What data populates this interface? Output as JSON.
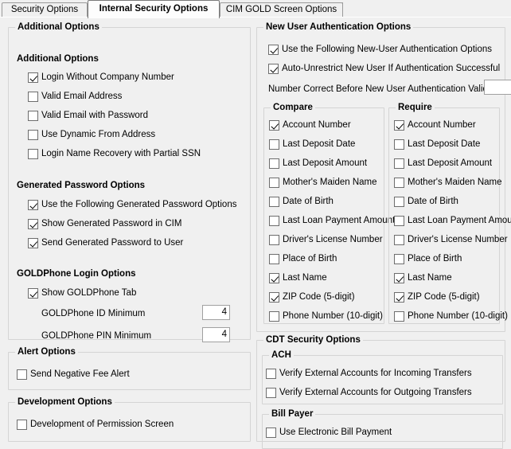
{
  "tabs": [
    {
      "id": "security-options",
      "label": "Security Options",
      "active": false
    },
    {
      "id": "internal-security-options",
      "label": "Internal Security Options",
      "active": true
    },
    {
      "id": "cim-gold-screen-options",
      "label": "CIM GOLD Screen Options",
      "active": false
    }
  ],
  "left": {
    "additional_options": {
      "group_title": "Additional Options",
      "section_head": "Additional Options",
      "items": [
        {
          "label": "Login Without Company Number",
          "checked": true
        },
        {
          "label": "Valid Email Address",
          "checked": false
        },
        {
          "label": "Valid Email with Password",
          "checked": false
        },
        {
          "label": "Use Dynamic From Address",
          "checked": false
        },
        {
          "label": "Login Name Recovery with Partial SSN",
          "checked": false
        }
      ]
    },
    "generated_password": {
      "section_head": "Generated Password Options",
      "items": [
        {
          "label": "Use the Following Generated Password Options",
          "checked": true
        },
        {
          "label": "Show Generated Password in CIM",
          "checked": true
        },
        {
          "label": "Send Generated Password to User",
          "checked": true
        }
      ]
    },
    "goldphone": {
      "section_head": "GOLDPhone Login Options",
      "items": [
        {
          "label": "Show GOLDPhone Tab",
          "checked": true
        }
      ],
      "fields": [
        {
          "label": "GOLDPhone ID Minimum",
          "value": "4"
        },
        {
          "label": "GOLDPhone PIN Minimum",
          "value": "4"
        }
      ]
    },
    "alert_options": {
      "group_title": "Alert Options",
      "items": [
        {
          "label": "Send Negative Fee Alert",
          "checked": false
        }
      ]
    },
    "development_options": {
      "group_title": "Development Options",
      "items": [
        {
          "label": "Development of Permission Screen",
          "checked": false
        }
      ]
    }
  },
  "right": {
    "new_user_auth": {
      "group_title": "New User Authentication Options",
      "items": [
        {
          "label": "Use the Following New-User Authentication Options",
          "checked": true
        },
        {
          "label": "Auto-Unrestrict New User If Authentication Successful",
          "checked": true
        }
      ],
      "number_correct": {
        "label": "Number Correct Before New User Authentication Valid",
        "value": ""
      },
      "compare": {
        "group_title": "Compare",
        "items": [
          {
            "label": "Account Number",
            "checked": true
          },
          {
            "label": "Last Deposit Date",
            "checked": false
          },
          {
            "label": "Last Deposit Amount",
            "checked": false
          },
          {
            "label": "Mother's Maiden Name",
            "checked": false
          },
          {
            "label": "Date of Birth",
            "checked": false
          },
          {
            "label": "Last Loan Payment Amount",
            "checked": false
          },
          {
            "label": "Driver's License Number",
            "checked": false
          },
          {
            "label": "Place of Birth",
            "checked": false
          },
          {
            "label": "Last Name",
            "checked": true
          },
          {
            "label": "ZIP Code (5-digit)",
            "checked": true
          },
          {
            "label": "Phone Number (10-digit)",
            "checked": false
          }
        ]
      },
      "require": {
        "group_title": "Require",
        "items": [
          {
            "label": "Account Number",
            "checked": true
          },
          {
            "label": "Last Deposit Date",
            "checked": false
          },
          {
            "label": "Last Deposit Amount",
            "checked": false
          },
          {
            "label": "Mother's Maiden Name",
            "checked": false
          },
          {
            "label": "Date of Birth",
            "checked": false
          },
          {
            "label": "Last Loan Payment Amount",
            "checked": false
          },
          {
            "label": "Driver's License Number",
            "checked": false
          },
          {
            "label": "Place of Birth",
            "checked": false
          },
          {
            "label": "Last Name",
            "checked": true
          },
          {
            "label": "ZIP Code (5-digit)",
            "checked": true
          },
          {
            "label": "Phone Number (10-digit)",
            "checked": false
          }
        ]
      }
    },
    "cdt_security": {
      "group_title": "CDT Security Options",
      "ach": {
        "group_title": "ACH",
        "items": [
          {
            "label": "Verify External Accounts for Incoming Transfers",
            "checked": false
          },
          {
            "label": "Verify External Accounts for Outgoing Transfers",
            "checked": false
          }
        ]
      },
      "bill_payer": {
        "group_title": "Bill Payer",
        "items": [
          {
            "label": "Use Electronic Bill Payment",
            "checked": false
          }
        ]
      }
    }
  },
  "colors": {
    "background": "#f0f0f0",
    "group_border": "#d4d4d4",
    "tab_border": "#888888",
    "active_tab_bg": "#fdfdfd",
    "field_bg": "#ffffff",
    "text": "#000000"
  }
}
